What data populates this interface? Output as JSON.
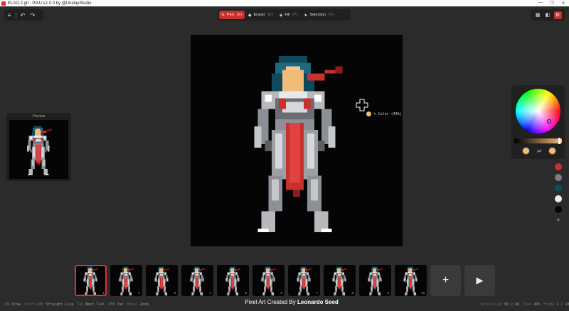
{
  "window": {
    "title": "ELAO.2.gif - PiXU v2.0.0 by @UnidayStudio",
    "controls": [
      "minimize",
      "restore",
      "close"
    ]
  },
  "top_left": {
    "icons": [
      "menu-icon",
      "undo-icon",
      "redo-icon"
    ]
  },
  "tools": [
    {
      "label": "Pen",
      "key": "(B)",
      "icon": "pen-icon",
      "active": true
    },
    {
      "label": "Eraser",
      "key": "(E)",
      "icon": "eraser-icon",
      "active": false
    },
    {
      "label": "Fill",
      "key": "(F)",
      "icon": "fill-icon",
      "active": false
    },
    {
      "label": "Selection",
      "key": "(V)",
      "icon": "cursor-icon",
      "active": false
    }
  ],
  "top_right": {
    "icons": [
      "grid-icon",
      "layers-icon",
      "settings-icon"
    ]
  },
  "preview": {
    "label": "Preview"
  },
  "tooltip": {
    "text": "Color (43%)"
  },
  "color_picker": {
    "current_color": "#f2bb76",
    "swap_icon": "swap-icon"
  },
  "palette": {
    "colors": [
      "#c6302d",
      "#7b7d82",
      "#0f4a5c",
      "#eeeeee",
      "#050505"
    ],
    "add_label": "+"
  },
  "frames": {
    "numbers": [
      "1",
      "2",
      "3",
      "4",
      "5",
      "6",
      "7",
      "8",
      "9",
      "10"
    ],
    "active_index": 0,
    "add_label": "+",
    "play_label": "▶"
  },
  "status_left": [
    {
      "key": "LMB",
      "label": "Draw"
    },
    {
      "key": "Shift+LMB",
      "label": "Straight Line"
    },
    {
      "key": "Tab",
      "label": "Next Tool"
    },
    {
      "key": "MMB",
      "label": "Pan"
    },
    {
      "key": "Wheel",
      "label": "Zoom"
    }
  ],
  "credit": {
    "prefix": "Pixel Art Created By",
    "author": "Leonardo Seed"
  },
  "status_right": [
    {
      "key": "Resolution",
      "value": "60 x 60"
    },
    {
      "key": "Zoom",
      "value": "49%"
    },
    {
      "key": "Frame",
      "value": "1 / 10"
    }
  ]
}
